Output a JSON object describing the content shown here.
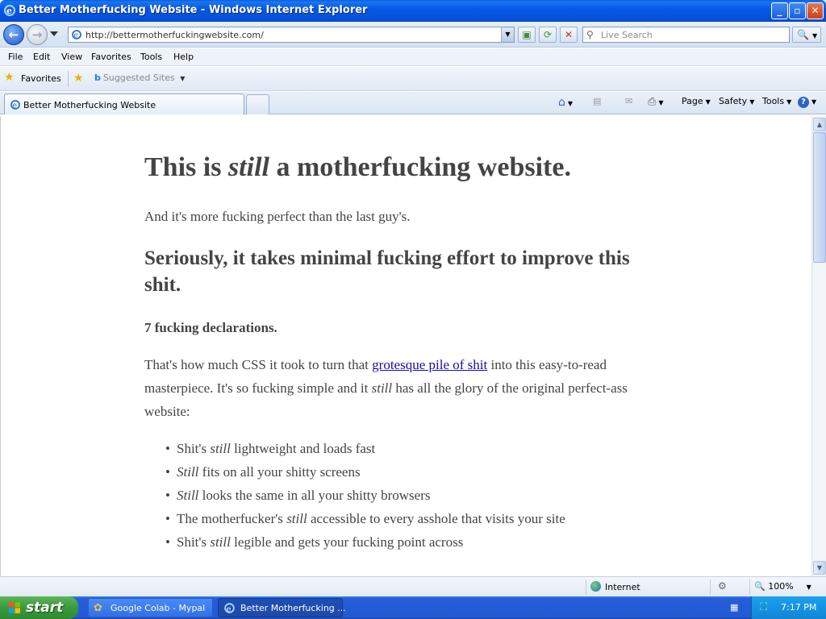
{
  "window": {
    "title": "Better Motherfucking Website - Windows Internet Explorer"
  },
  "address_bar": {
    "url": "http://bettermotherfuckingwebsite.com/",
    "search_placeholder": "Live Search"
  },
  "menu": {
    "items": [
      "File",
      "Edit",
      "View",
      "Favorites",
      "Tools",
      "Help"
    ]
  },
  "favorites_bar": {
    "favorites_label": "Favorites",
    "suggested_label": "Suggested Sites"
  },
  "tabs": {
    "active_tab_label": "Better Motherfucking Website"
  },
  "command_bar": {
    "page": "Page",
    "safety": "Safety",
    "tools": "Tools"
  },
  "page": {
    "h1_before": "This is ",
    "h1_em": "still",
    "h1_after": " a motherfucking website.",
    "lead": "And it's more fucking perfect than the last guy's.",
    "h2": "Seriously, it takes minimal fucking effort to improve this shit.",
    "h3": "7 fucking declarations.",
    "para_before": "That's how much CSS it took to turn that ",
    "para_link": "grotesque pile of shit",
    "para_mid1": " into this easy-to-read masterpiece. It's so fucking simple and it ",
    "para_em": "still",
    "para_after": " has all the glory of the original perfect-ass website:",
    "bullets": [
      {
        "before": "Shit's ",
        "em": "still",
        "after": " lightweight and loads fast"
      },
      {
        "before": "",
        "em": "Still",
        "after": " fits on all your shitty screens"
      },
      {
        "before": "",
        "em": "Still",
        "after": " looks the same in all your shitty browsers"
      },
      {
        "before": "The motherfucker's ",
        "em": "still",
        "after": " accessible to every asshole that visits your site"
      },
      {
        "before": "Shit's ",
        "em": "still",
        "after": " legible and gets your fucking point across"
      }
    ]
  },
  "status_bar": {
    "zone": "Internet",
    "zoom": "100%"
  },
  "taskbar": {
    "start_label": "start",
    "items": [
      "Google Colab - Mypal",
      "Better Motherfucking ..."
    ],
    "clock": "7:17 PM"
  }
}
